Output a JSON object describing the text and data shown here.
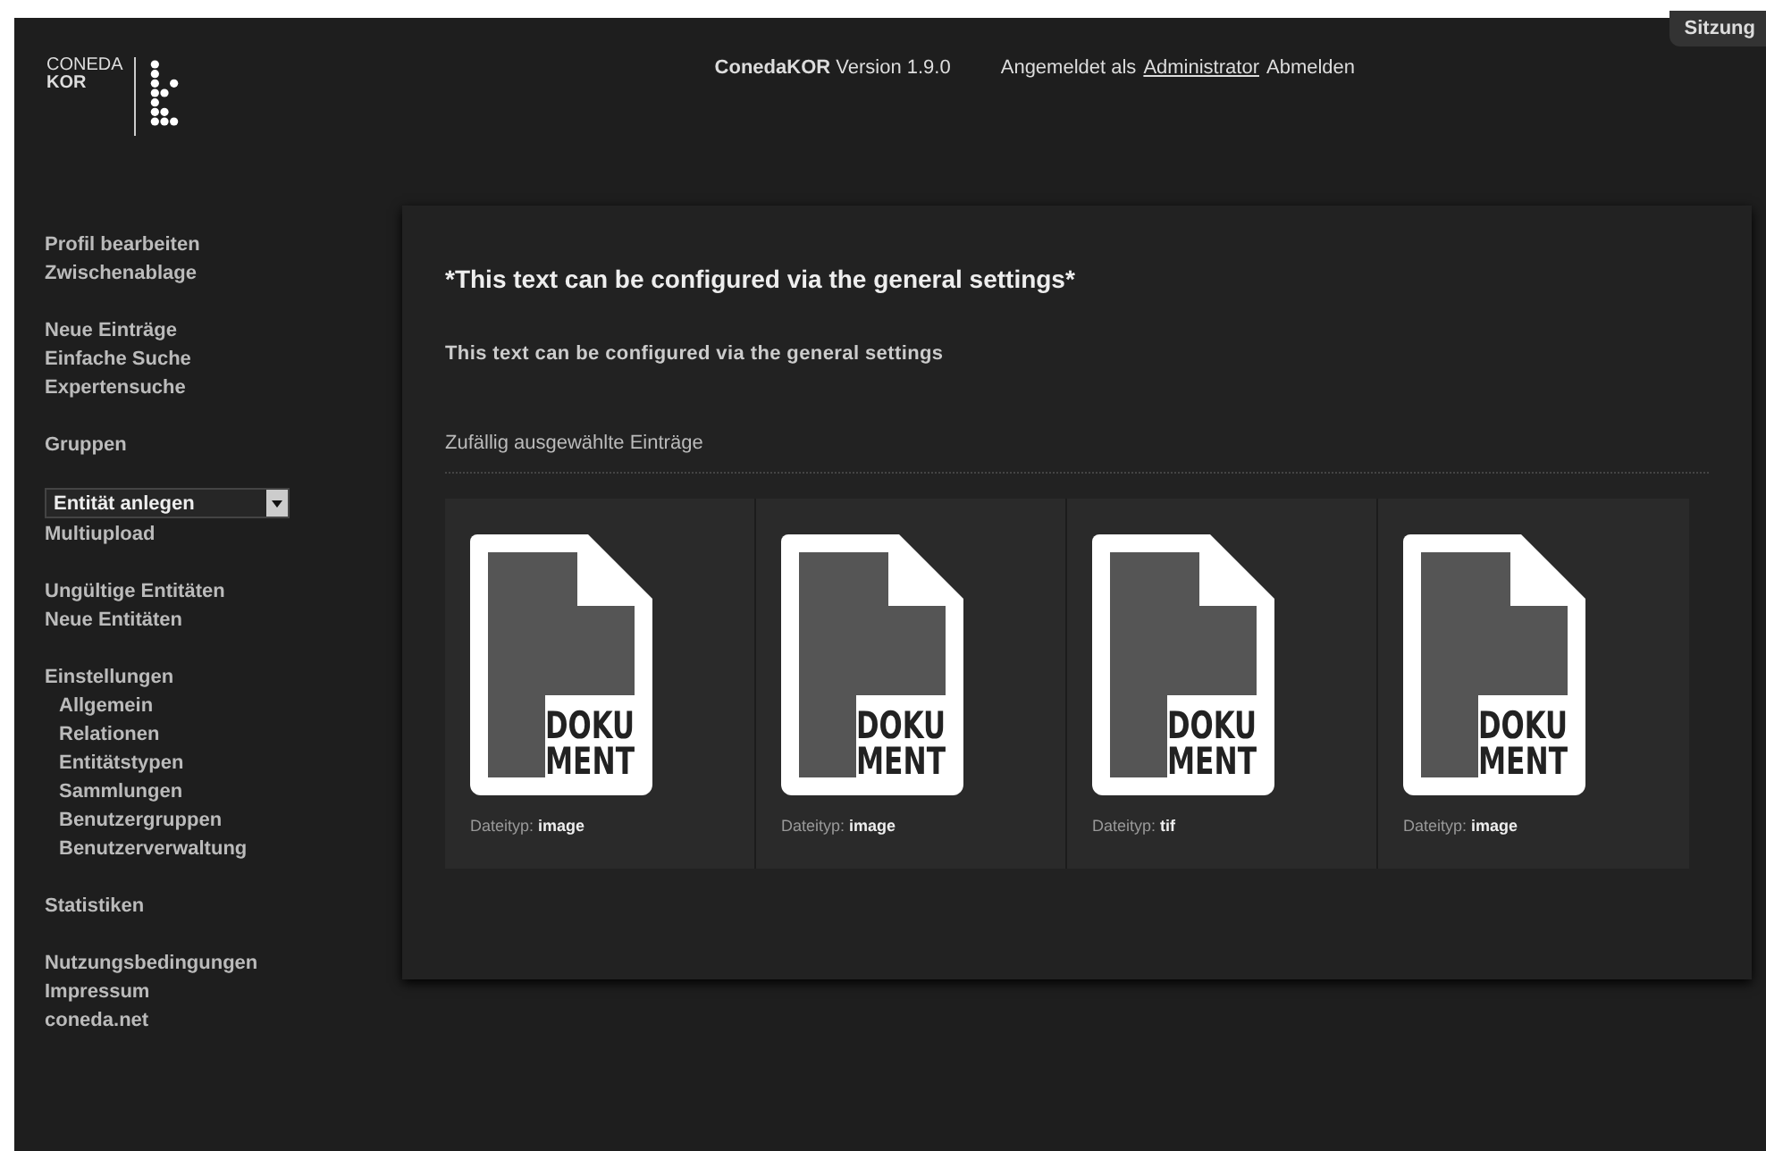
{
  "header": {
    "logo": {
      "top": "CONEDA",
      "bottom": "KOR"
    },
    "version": "**ConedaKOR** Version 1.9.0",
    "login_text": "Angemeldet als",
    "user": "Administrator",
    "logout": "Abmelden",
    "session_tab": "Sitzung"
  },
  "sidebar": {
    "groups": [
      {
        "items": [
          {
            "kind": "link",
            "label": "Profil bearbeiten"
          },
          {
            "kind": "link",
            "label": "Zwischenablage"
          }
        ]
      },
      {
        "items": [
          {
            "kind": "link",
            "label": "Neue Einträge"
          },
          {
            "kind": "link",
            "label": "Einfache Suche"
          },
          {
            "kind": "link",
            "label": "Expertensuche"
          }
        ]
      },
      {
        "items": [
          {
            "kind": "link",
            "label": "Gruppen"
          }
        ]
      },
      {
        "items": [
          {
            "kind": "select",
            "label": "Entität anlegen"
          },
          {
            "kind": "link",
            "label": "Multiupload"
          }
        ]
      },
      {
        "items": [
          {
            "kind": "link",
            "label": "Ungültige Entitäten"
          },
          {
            "kind": "link",
            "label": "Neue Entitäten"
          }
        ]
      },
      {
        "items": [
          {
            "kind": "link",
            "label": "Einstellungen",
            "children": [
              {
                "label": "Allgemein"
              },
              {
                "label": "Relationen"
              },
              {
                "label": "Entitätstypen"
              },
              {
                "label": "Sammlungen"
              },
              {
                "label": "Benutzergruppen"
              },
              {
                "label": "Benutzerverwaltung"
              }
            ]
          }
        ]
      },
      {
        "items": [
          {
            "kind": "link",
            "label": "Statistiken"
          }
        ]
      },
      {
        "items": [
          {
            "kind": "link",
            "label": "Nutzungsbedingungen"
          },
          {
            "kind": "link",
            "label": "Impressum"
          },
          {
            "kind": "link",
            "label": "coneda.net"
          }
        ]
      }
    ]
  },
  "main": {
    "heading": "*This text can be configured via the general settings*",
    "subheading": "This text can be configured via the general settings",
    "section_title": "Zufällig ausgewählte Einträge",
    "entries": [
      {
        "thumbnail_text": [
          "DOKU",
          "MENT"
        ],
        "file_type": "Dateityp: **image**"
      },
      {
        "thumbnail_text": [
          "DOKU",
          "MENT"
        ],
        "file_type": "Dateityp: **image**"
      },
      {
        "thumbnail_text": [
          "DOKU",
          "MENT"
        ],
        "file_type": "Dateityp: **tif**"
      },
      {
        "thumbnail_text": [
          "DOKU",
          "MENT"
        ],
        "file_type": "Dateityp: **image**"
      }
    ]
  }
}
